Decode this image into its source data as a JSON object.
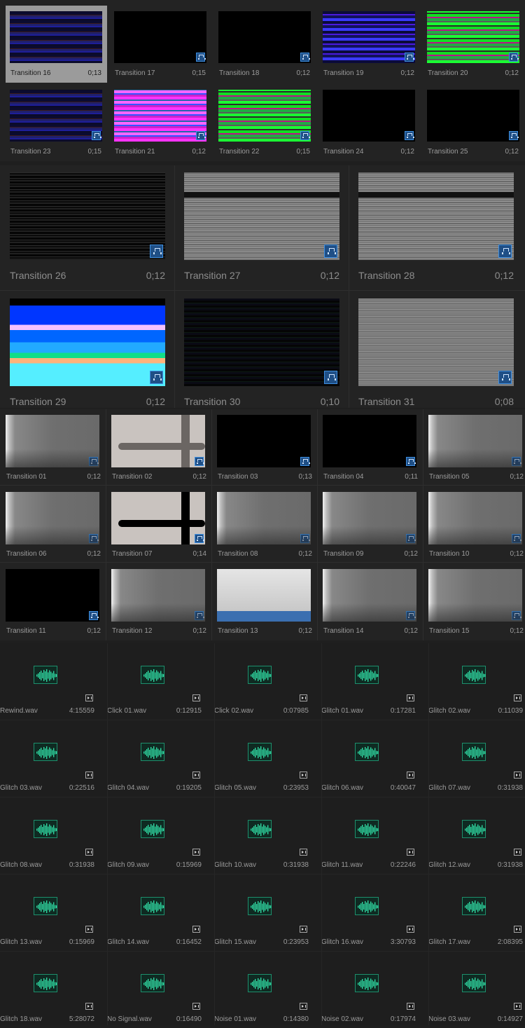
{
  "section1": {
    "items": [
      {
        "label": "Transition 16",
        "duration": "0;13"
      },
      {
        "label": "Transition 17",
        "duration": "0;15"
      },
      {
        "label": "Transition 18",
        "duration": "0;12"
      },
      {
        "label": "Transition 19",
        "duration": "0;12"
      },
      {
        "label": "Transition 20",
        "duration": "0;12"
      },
      {
        "label": "Transition 23",
        "duration": "0;15"
      },
      {
        "label": "Transition 21",
        "duration": "0;12"
      },
      {
        "label": "Transition 22",
        "duration": "0;15"
      },
      {
        "label": "Transition 24",
        "duration": "0;12"
      },
      {
        "label": "Transition 25",
        "duration": "0;12"
      }
    ]
  },
  "section2": {
    "items": [
      {
        "label": "Transition 26",
        "duration": "0;12"
      },
      {
        "label": "Transition 27",
        "duration": "0;12"
      },
      {
        "label": "Transition 28",
        "duration": "0;12"
      },
      {
        "label": "Transition 29",
        "duration": "0;12"
      },
      {
        "label": "Transition 30",
        "duration": "0;10"
      },
      {
        "label": "Transition 31",
        "duration": "0;08"
      }
    ]
  },
  "section3": {
    "items": [
      {
        "label": "Transition 01",
        "duration": "0;12"
      },
      {
        "label": "Transition 02",
        "duration": "0;12"
      },
      {
        "label": "Transition 03",
        "duration": "0;13"
      },
      {
        "label": "Transition 04",
        "duration": "0;11"
      },
      {
        "label": "Transition 05",
        "duration": "0;12"
      },
      {
        "label": "Transition 06",
        "duration": "0;12"
      },
      {
        "label": "Transition 07",
        "duration": "0;14"
      },
      {
        "label": "Transition 08",
        "duration": "0;12"
      },
      {
        "label": "Transition 09",
        "duration": "0;12"
      },
      {
        "label": "Transition 10",
        "duration": "0;12"
      },
      {
        "label": "Transition 11",
        "duration": "0;12"
      },
      {
        "label": "Transition 12",
        "duration": "0;12"
      },
      {
        "label": "Transition 13",
        "duration": "0;12"
      },
      {
        "label": "Transition 14",
        "duration": "0;12"
      },
      {
        "label": "Transition 15",
        "duration": "0;12"
      }
    ]
  },
  "audio": {
    "items": [
      {
        "label": "Rewind.wav",
        "duration": "4:15559"
      },
      {
        "label": "Click 01.wav",
        "duration": "0:12915"
      },
      {
        "label": "Click 02.wav",
        "duration": "0:07985"
      },
      {
        "label": "Glitch 01.wav",
        "duration": "0:17281"
      },
      {
        "label": "Glitch 02.wav",
        "duration": "0:11039"
      },
      {
        "label": "Glitch 03.wav",
        "duration": "0:22516"
      },
      {
        "label": "Glitch 04.wav",
        "duration": "0:19205"
      },
      {
        "label": "Glitch 05.wav",
        "duration": "0:23953"
      },
      {
        "label": "Glitch 06.wav",
        "duration": "0:40047"
      },
      {
        "label": "Glitch 07.wav",
        "duration": "0:31938"
      },
      {
        "label": "Glitch 08.wav",
        "duration": "0:31938"
      },
      {
        "label": "Glitch 09.wav",
        "duration": "0:15969"
      },
      {
        "label": "Glitch 10.wav",
        "duration": "0:31938"
      },
      {
        "label": "Glitch 11.wav",
        "duration": "0:22246"
      },
      {
        "label": "Glitch 12.wav",
        "duration": "0:31938"
      },
      {
        "label": "Glitch 13.wav",
        "duration": "0:15969"
      },
      {
        "label": "Glitch 14.wav",
        "duration": "0:16452"
      },
      {
        "label": "Glitch 15.wav",
        "duration": "0:23953"
      },
      {
        "label": "Glitch 16.wav",
        "duration": "3:30793"
      },
      {
        "label": "Glitch 17.wav",
        "duration": "2:08395"
      },
      {
        "label": "Glitch 18.wav",
        "duration": "5:28072"
      },
      {
        "label": "No Signal.wav",
        "duration": "0:16490"
      },
      {
        "label": "Noise 01.wav",
        "duration": "0:14380"
      },
      {
        "label": "Noise 02.wav",
        "duration": "0:17974"
      },
      {
        "label": "Noise 03.wav",
        "duration": "0:14927"
      }
    ]
  },
  "colors": {
    "accent": "#3d8ee0",
    "selected": "#9b9b9b",
    "wave": "#2fd6a0"
  }
}
